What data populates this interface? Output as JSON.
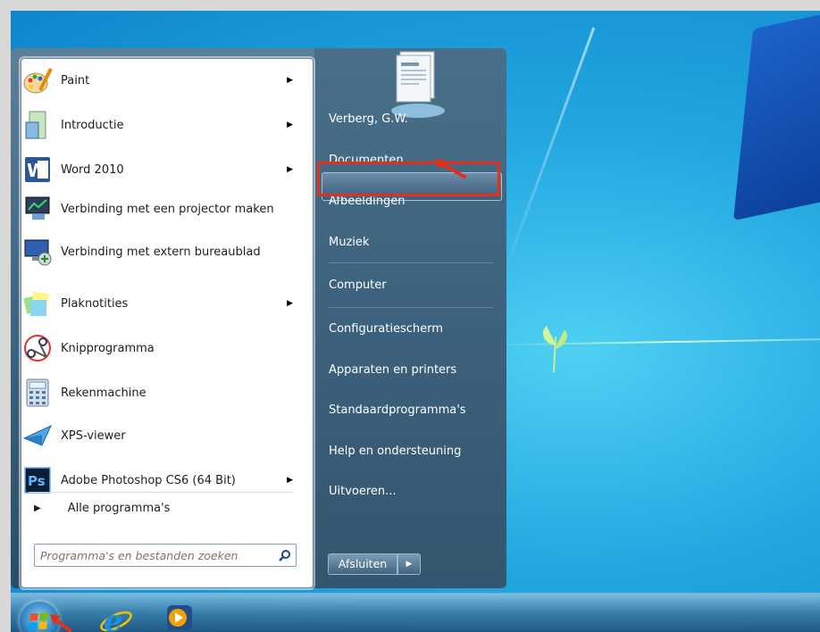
{
  "programs": [
    {
      "label": "Paint",
      "has_submenu": true,
      "icon": "paint-icon"
    },
    {
      "label": "Introductie",
      "has_submenu": true,
      "icon": "introductie-icon"
    },
    {
      "label": "Word 2010",
      "has_submenu": true,
      "icon": "word-icon"
    },
    {
      "label": "Verbinding met een projector maken",
      "has_submenu": false,
      "icon": "projector-icon"
    },
    {
      "label": "Verbinding met extern bureaublad",
      "has_submenu": false,
      "icon": "remote-desktop-icon"
    },
    {
      "label": "Plaknotities",
      "has_submenu": true,
      "icon": "sticky-notes-icon"
    },
    {
      "label": "Knipprogramma",
      "has_submenu": false,
      "icon": "snipping-tool-icon"
    },
    {
      "label": "Rekenmachine",
      "has_submenu": false,
      "icon": "calculator-icon"
    },
    {
      "label": "XPS-viewer",
      "has_submenu": false,
      "icon": "xps-viewer-icon"
    },
    {
      "label": "Adobe Photoshop CS6 (64 Bit)",
      "has_submenu": true,
      "icon": "photoshop-icon"
    }
  ],
  "all_programs": "Alle programma's",
  "search": {
    "placeholder": "Programma's en bestanden zoeken"
  },
  "right_items": [
    {
      "label": "Verberg, G.W."
    },
    {
      "label": "Documenten",
      "highlighted": true
    },
    {
      "label": "Afbeeldingen"
    },
    {
      "label": "Muziek"
    },
    {
      "label": "Computer"
    },
    {
      "label": "Configuratiescherm"
    },
    {
      "label": "Apparaten en printers"
    },
    {
      "label": "Standaardprogramma's"
    },
    {
      "label": "Help en ondersteuning"
    },
    {
      "label": "Uitvoeren..."
    }
  ],
  "shutdown": {
    "label": "Afsluiten"
  },
  "colors": {
    "highlight_box": "#e0301e",
    "arrow": "#e0301e"
  }
}
